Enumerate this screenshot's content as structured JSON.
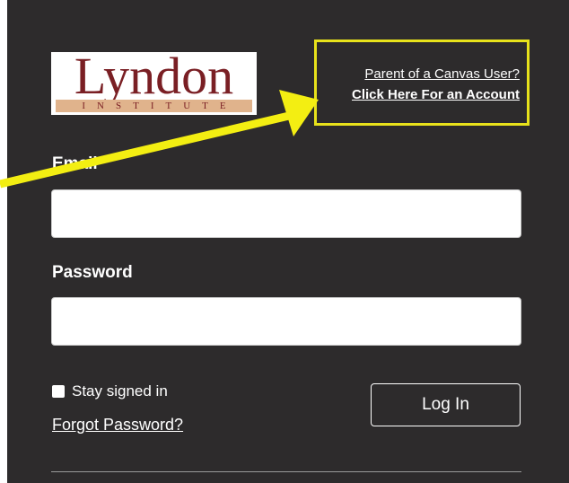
{
  "logo": {
    "word": "Lyndon",
    "band": "INSTITUTE"
  },
  "parent_link": {
    "line1": "Parent of a Canvas User?",
    "line2": "Click Here For an Account"
  },
  "form": {
    "email_label": "Email",
    "email_value": "",
    "password_label": "Password",
    "password_value": "",
    "stay_signed_in_label": "Stay signed in",
    "stay_signed_in_checked": true,
    "forgot_password_label": "Forgot Password?",
    "login_button_label": "Log In"
  },
  "colors": {
    "panel_background": "#2d2b2c",
    "highlight_border": "#e8e21b",
    "arrow": "#f3ee12",
    "logo_text": "#7a1f24",
    "logo_band": "#e0b38c"
  }
}
